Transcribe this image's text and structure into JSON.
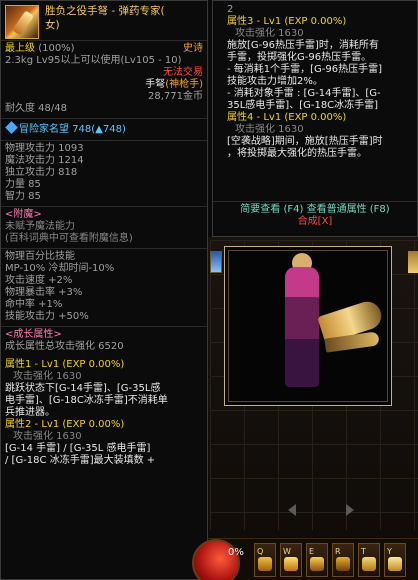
{
  "left": {
    "name_line1": "胜负之役手弩 - 弹药专家(",
    "name_line2": "女)",
    "level_label": "最上级",
    "level_pct": "(100%)",
    "rarity": "史诗",
    "weight": "2.3kg",
    "level_req": "Lv95以上可以使用(Lv105 - 10)",
    "trade": "无法交易",
    "weapon_type_prefix": "手弩",
    "weapon_type_owner": "(神枪手)",
    "price": "28,771金币",
    "durability": "耐久度 48/48",
    "adventurer_fame_label": "冒险家名望",
    "adventurer_fame_value": "748(▲748)",
    "stats": [
      "物理攻击力 1093",
      "魔法攻击力 1214",
      "独立攻击力 818",
      "力量 85",
      "智力 85"
    ],
    "enchant_title": "<附魔>",
    "enchant_line1": "未赋予魔法能力",
    "enchant_line2": "(百科词典中可查看附魔信息)",
    "effects": [
      "物理百分比技能",
      " MP-10% 冷却时间-10%",
      "攻击速度 +2%",
      "物理暴击率 +3%",
      "命中率 +1%",
      "技能攻击力 +50%"
    ],
    "growth_title": "<成长属性>",
    "growth_total": "成长属性总攻击强化 6520",
    "attr1_title": "属性1 - Lv1 (EXP 0.00%)",
    "attr1_sub": "攻击强化 1630",
    "attr1_desc": [
      "跳跃状态下[G-14手雷]、[G-35L感",
      "电手雷]、[G-18C冰冻手雷]不消耗单",
      "兵推进器。"
    ],
    "attr2_title": "属性2 - Lv1 (EXP 0.00%)",
    "attr2_sub": "攻击强化 1630",
    "attr2_desc": [
      "[G-14 手雷] / [G-35L 感电手雷]",
      "/ [G-18C 冰冻手雷]最大装填数 +"
    ]
  },
  "right": {
    "top_num": "2",
    "attr3_title": "属性3 - Lv1 (EXP 0.00%)",
    "attr3_sub": "攻击强化 1630",
    "attr3_desc": [
      "施放[G-96热压手雷]时，消耗所有",
      "手雷，投掷强化G-96热压手雷。",
      "- 每消耗1个手雷，[G-96热压手雷]",
      "技能攻击力增加2%。",
      "- 消耗对象手雷 : [G-14手雷]、[G-",
      "35L感电手雷]、[G-18C冰冻手雷]"
    ],
    "attr4_title": "属性4 - Lv1 (EXP 0.00%)",
    "attr4_sub": "攻击强化 1630",
    "attr4_desc": [
      "[空袭战略]期间，施放[热压手雷]时",
      "，将投掷最大强化的热压手雷。"
    ],
    "action_brief": "简要查看 (F4)",
    "action_normal": "查看普通属性 (F8)",
    "action_combine": "合成[X]"
  },
  "hotbar": {
    "orb_text": "0%",
    "keys": [
      "Q",
      "W",
      "E",
      "R",
      "T",
      "Y"
    ]
  },
  "colors": {
    "epic": "#f5c85a",
    "yellow": "#f2d21a",
    "red": "#ff4a3a",
    "green": "#6cd9c0",
    "blue": "#5cc6ff"
  }
}
